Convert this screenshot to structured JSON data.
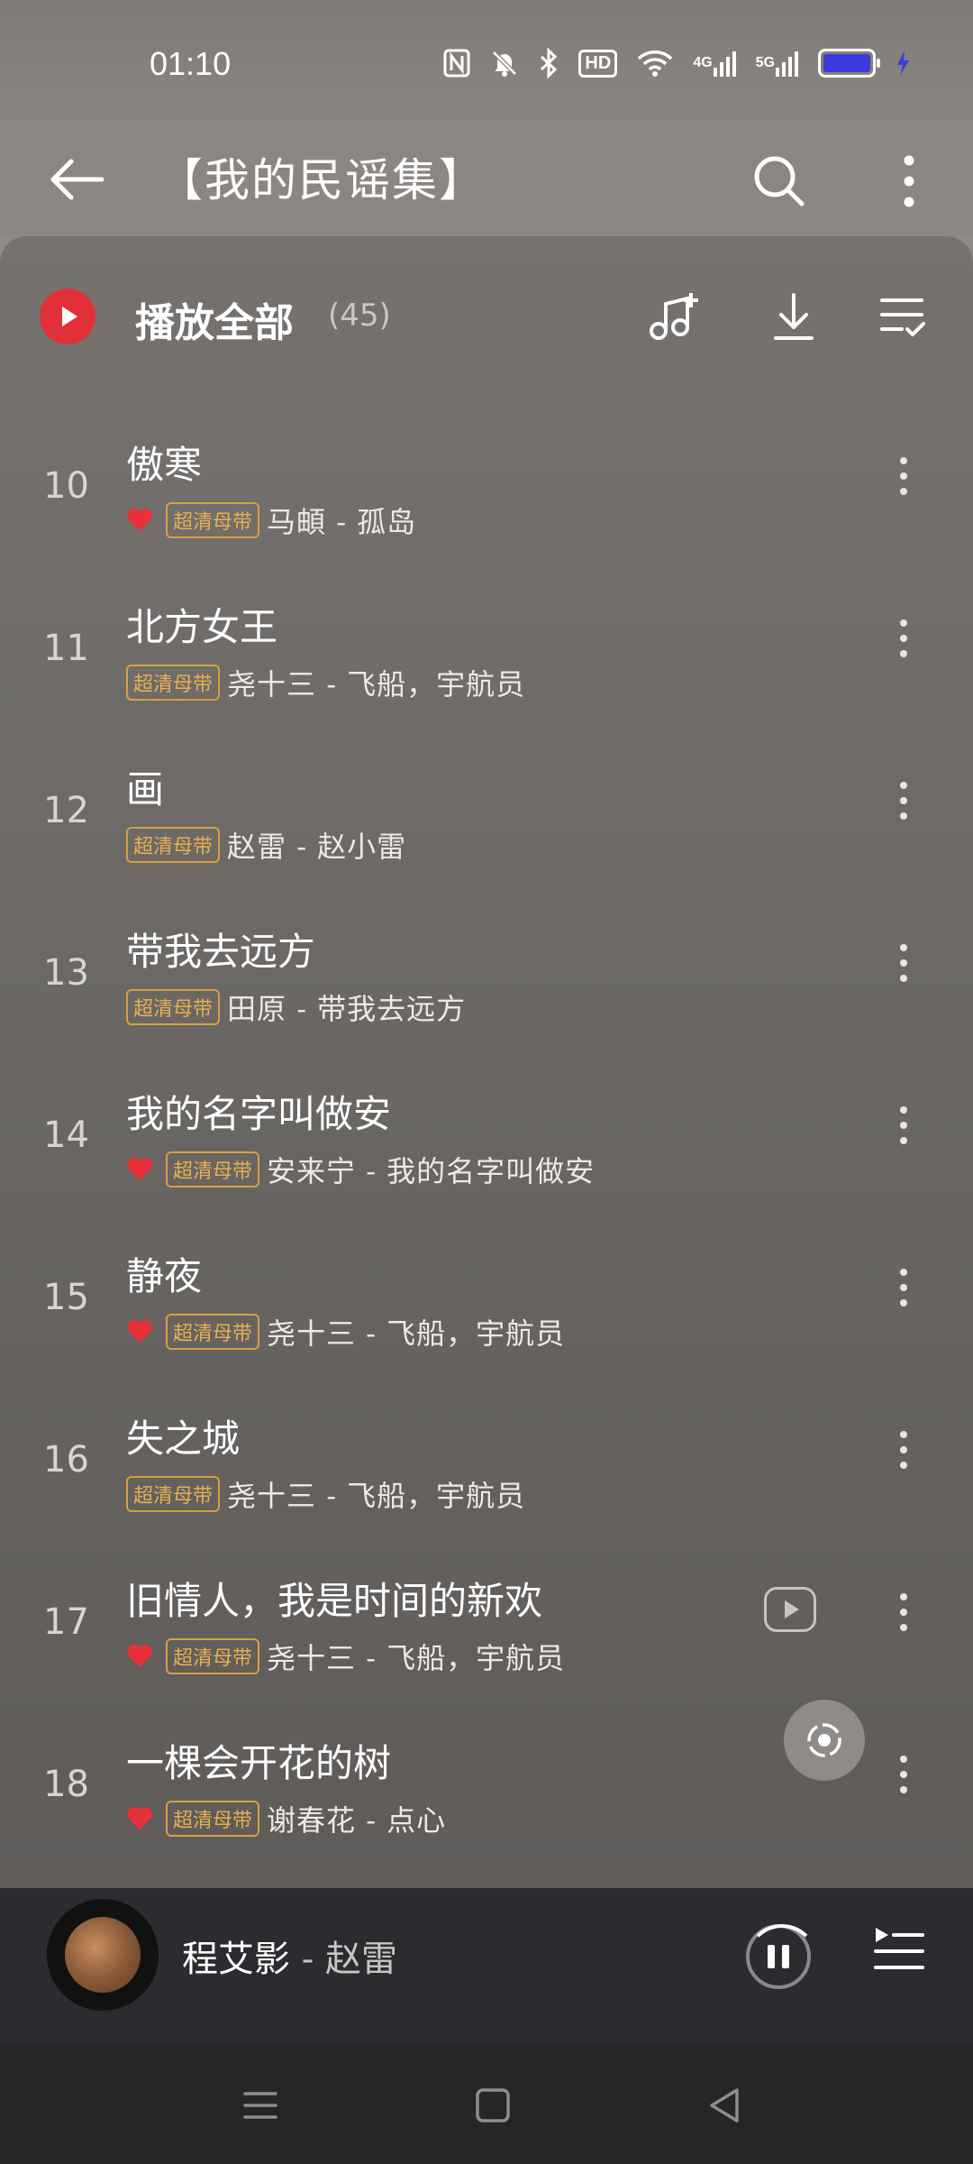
{
  "status_bar": {
    "time": "01:10",
    "hd_label": "HD",
    "net1": "4G",
    "net2": "5G"
  },
  "header": {
    "title": "【我的民谣集】"
  },
  "play_all": {
    "label": "播放全部",
    "count": "(45)"
  },
  "songs": [
    {
      "num": "10",
      "title": "傲寒",
      "liked": true,
      "badge": "超清母带",
      "artist": "马頔 - 孤岛",
      "mv": false
    },
    {
      "num": "11",
      "title": "北方女王",
      "liked": false,
      "badge": "超清母带",
      "artist": "尧十三 - 飞船，宇航员",
      "mv": false
    },
    {
      "num": "12",
      "title": "画",
      "liked": false,
      "badge": "超清母带",
      "artist": "赵雷 - 赵小雷",
      "mv": false
    },
    {
      "num": "13",
      "title": "带我去远方",
      "liked": false,
      "badge": "超清母带",
      "artist": "田原 - 带我去远方",
      "mv": false
    },
    {
      "num": "14",
      "title": "我的名字叫做安",
      "liked": true,
      "badge": "超清母带",
      "artist": "安来宁 - 我的名字叫做安",
      "mv": false
    },
    {
      "num": "15",
      "title": "静夜",
      "liked": true,
      "badge": "超清母带",
      "artist": "尧十三 - 飞船，宇航员",
      "mv": false
    },
    {
      "num": "16",
      "title": "失之城",
      "liked": false,
      "badge": "超清母带",
      "artist": "尧十三 - 飞船，宇航员",
      "mv": false
    },
    {
      "num": "17",
      "title": "旧情人，我是时间的新欢",
      "liked": true,
      "badge": "超清母带",
      "artist": "尧十三 - 飞船，宇航员",
      "mv": true
    },
    {
      "num": "18",
      "title": "一棵会开花的树",
      "liked": true,
      "badge": "超清母带",
      "artist": "谢春花 - 点心",
      "mv": false
    }
  ],
  "now_playing": {
    "title": "程艾影",
    "artist": " - 赵雷"
  },
  "icons": {
    "back": "back-arrow-icon",
    "search": "search-icon",
    "more": "more-vertical-icon",
    "add_music": "add-music-icon",
    "download": "download-icon",
    "multi_select": "list-check-icon"
  },
  "colors": {
    "accent_red": "#e2303b",
    "badge_gold": "#d9a040"
  }
}
